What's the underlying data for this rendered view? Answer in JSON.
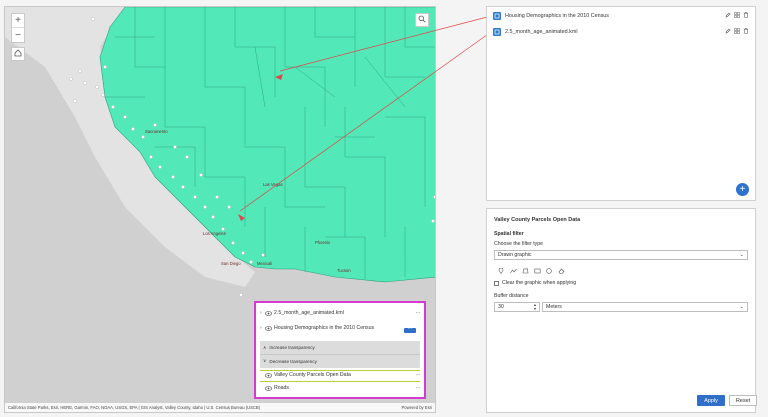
{
  "map": {
    "zoom_in": "+",
    "zoom_out": "−",
    "cities": [
      "Las Vegas",
      "Los Angeles",
      "San Diego",
      "Mexicali",
      "Phoenix",
      "Tucson",
      "Sacramento"
    ],
    "attribution": "California State Parks, Esri, HERE, Garmin, FAO, NOAA, USGS, EPA | GIS Analyst, Valley County, Idaho | U.S. Census Bureau (USCB)",
    "powered_by": "Powered by Esri"
  },
  "layer_list": {
    "items": [
      {
        "label": "2.5_month_age_animated.kml",
        "more": "···"
      },
      {
        "label": "Housing Demographics in the 2010 Census",
        "more": "···"
      }
    ],
    "transparency": {
      "increase": "Increase transparency",
      "decrease": "Decrease transparency"
    },
    "lower_items": [
      {
        "label": "Valley County Parcels Open Data",
        "more": "···"
      },
      {
        "label": "Roads",
        "more": "···"
      }
    ]
  },
  "layers_panel": {
    "items": [
      {
        "label": "Housing Demographics in the 2010 Census"
      },
      {
        "label": "2.5_month_age_animated.kml"
      }
    ],
    "add_button": "+"
  },
  "filter_panel": {
    "title": "Valley County Parcels Open Data",
    "section": "Spatial filter",
    "filter_type_label": "Choose the filter type",
    "filter_type_value": "Drawn graphic",
    "clear_label": "Clear the graphic when applying",
    "buffer_label": "Buffer distance",
    "buffer_value": "30",
    "buffer_unit": "Meters",
    "apply": "Apply",
    "reset": "Reset"
  },
  "colors": {
    "polygon_fill": "#52e8b8",
    "accent": "#2f6ec9",
    "highlight_border": "#d23ad0",
    "arrow": "#e04848"
  }
}
